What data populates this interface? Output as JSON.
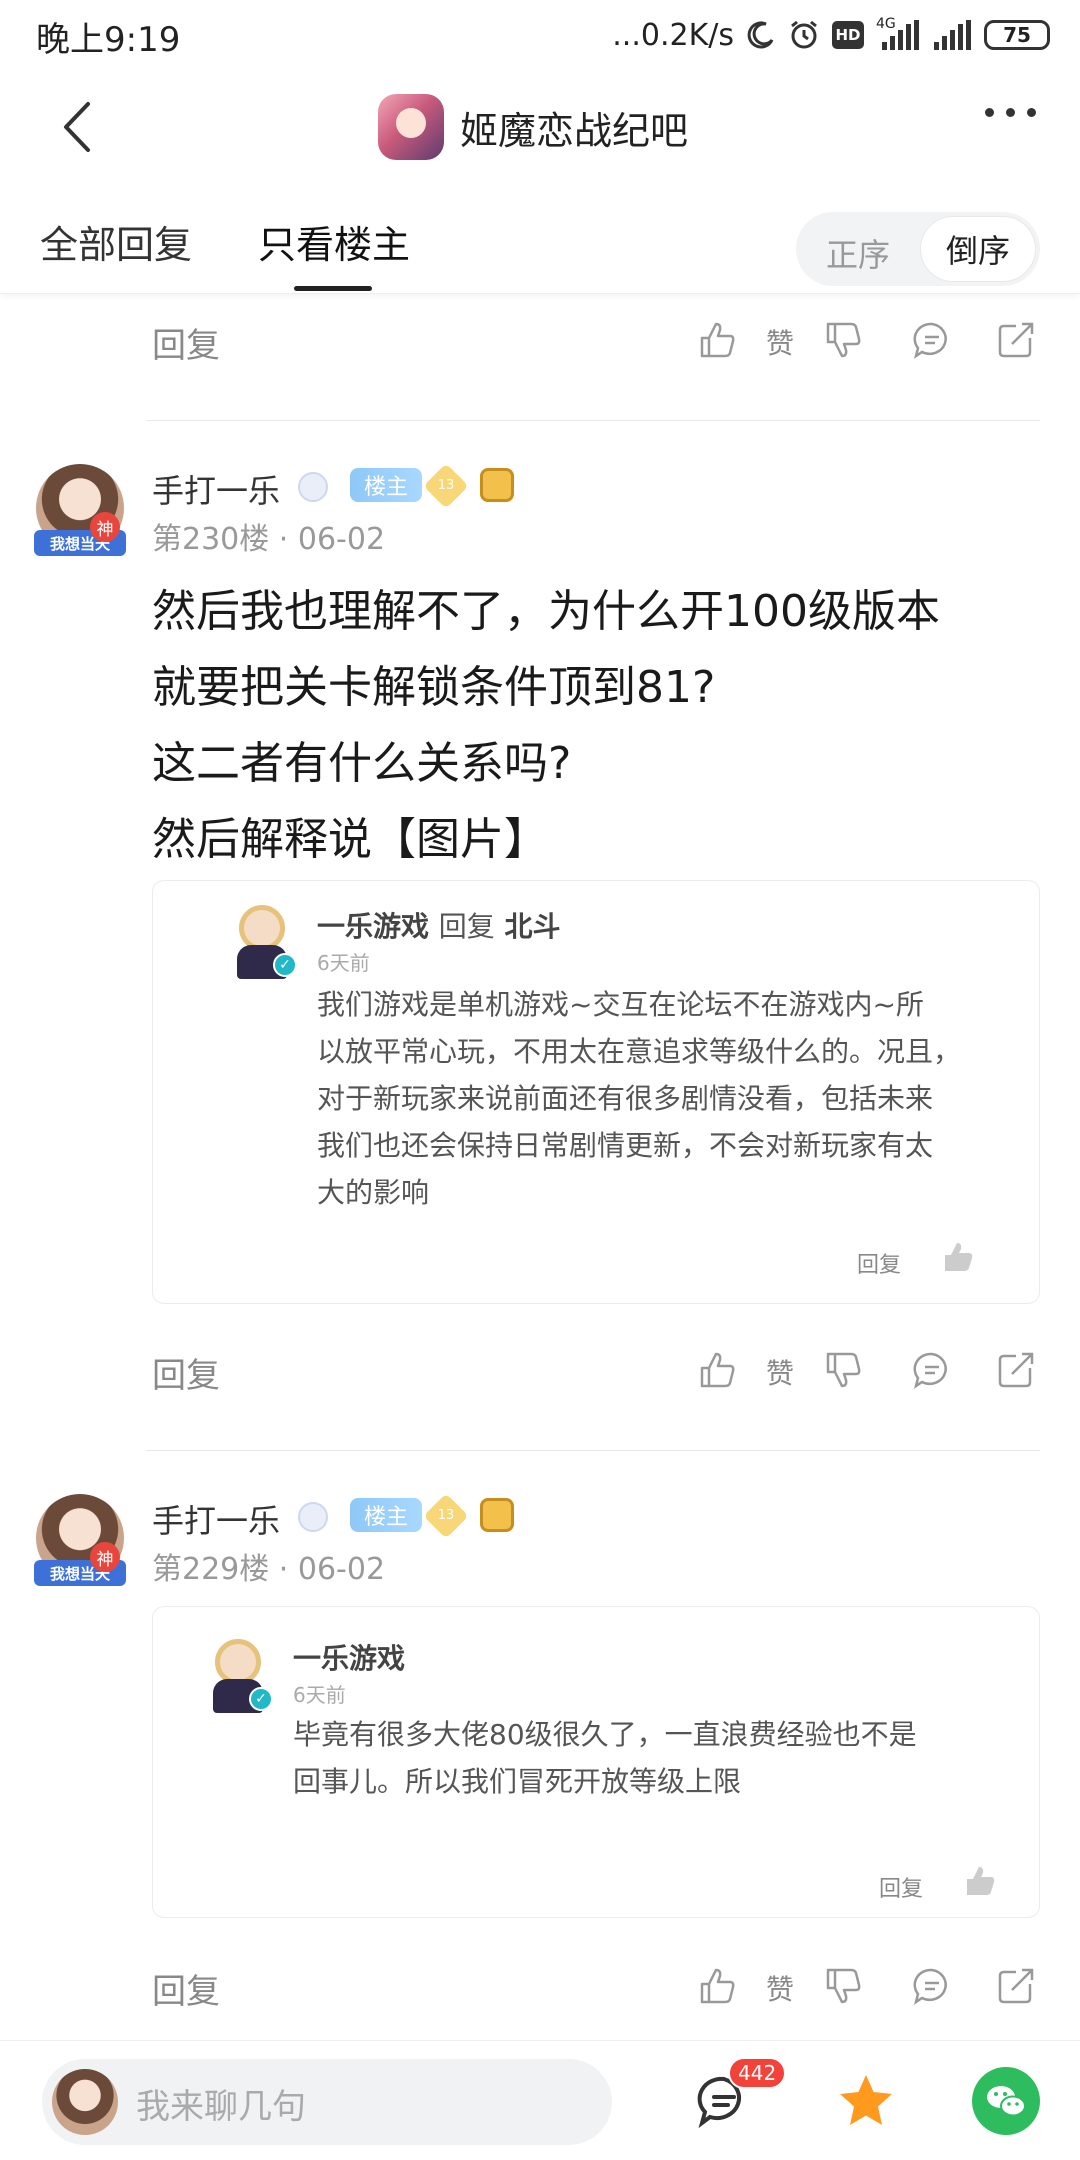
{
  "status_bar": {
    "time": "晚上9:19",
    "speed": "...0.2K/s",
    "hd": "HD",
    "network": "4G",
    "battery": "75"
  },
  "header": {
    "title": "姬魔恋战纪吧"
  },
  "tabs": {
    "all": "全部回复",
    "owner_only": "只看楼主",
    "order_asc": "正序",
    "order_desc": "倒序"
  },
  "actions": {
    "reply": "回复",
    "like": "赞"
  },
  "posts": [
    {
      "username": "手打一乐",
      "owner_badge": "楼主",
      "level": "13",
      "avatar_banner": "我想当天",
      "avatar_god": "神",
      "floor": "第230楼",
      "date": "06-02",
      "lines": [
        "然后我也理解不了，为什么开100级版本",
        "就要把关卡解锁条件顶到81?",
        "这二者有什么关系吗?",
        "然后解释说【图片】"
      ],
      "quote": {
        "name": "一乐游戏",
        "reply_word": "回复",
        "reply_to": "北斗",
        "time": "6天前",
        "lines": [
          "我们游戏是单机游戏~交互在论坛不在游戏内~所",
          "以放平常心玩，不用太在意追求等级什么的。况且，",
          "对于新玩家来说前面还有很多剧情没看，包括未来",
          "我们也还会保持日常剧情更新，不会对新玩家有太",
          "大的影响"
        ],
        "reply_label": "回复"
      }
    },
    {
      "username": "手打一乐",
      "owner_badge": "楼主",
      "level": "13",
      "avatar_banner": "我想当天",
      "avatar_god": "神",
      "floor": "第229楼",
      "date": "06-02",
      "quote": {
        "name": "一乐游戏",
        "time": "6天前",
        "lines": [
          "毕竟有很多大佬80级很久了，一直浪费经验也不是",
          "回事儿。所以我们冒死开放等级上限"
        ],
        "reply_label": "回复"
      }
    }
  ],
  "bottom_bar": {
    "placeholder": "我来聊几句",
    "comment_count": "442"
  },
  "colors": {
    "accent_blue": "#8ec8f7",
    "badge_red": "#f2423a",
    "star_orange": "#ff9a1f",
    "wechat_green": "#2dbd5f"
  }
}
